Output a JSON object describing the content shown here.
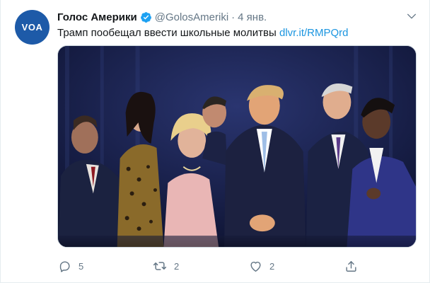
{
  "tweet": {
    "avatar_text": "VOA",
    "author_name": "Голос Америки",
    "handle": "@GolosAmeriki",
    "separator": "·",
    "date": "4 янв.",
    "text": "Трамп пообещал ввести школьные молитвы ",
    "link": "dlvr.it/RMPQrd"
  },
  "actions": {
    "reply_count": "5",
    "retweet_count": "2",
    "like_count": "2"
  },
  "icons": {
    "verified": "verified-badge-icon",
    "caret": "chevron-down-icon",
    "reply": "reply-icon",
    "retweet": "retweet-icon",
    "like": "heart-icon",
    "share": "share-icon"
  },
  "colors": {
    "accent": "#1da1f2",
    "link": "#1b95e0",
    "muted": "#657786",
    "avatar_bg": "#1d5aa8"
  }
}
